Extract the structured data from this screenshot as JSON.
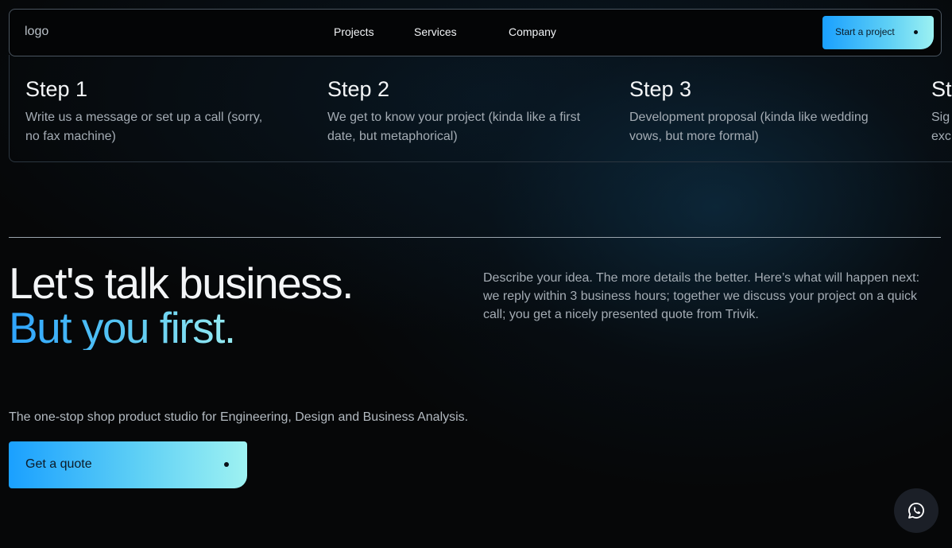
{
  "nav": {
    "logo": "logo",
    "links": [
      "Projects",
      "Services",
      "Company"
    ],
    "cta_label": "Start a project"
  },
  "steps": [
    {
      "title": "Step 1",
      "description": "Write us a message or set up a call (sorry, no fax machine)"
    },
    {
      "title": "Step 2",
      "description": "We get to know your project (kinda like a first date, but metaphorical)"
    },
    {
      "title": "Step 3",
      "description": "Development proposal (kinda like wedding vows, but more formal)"
    },
    {
      "title": "St",
      "description": "Sig exc"
    }
  ],
  "hero": {
    "headline_line1": "Let's talk business.",
    "headline_line2": "But you first.",
    "intro": "Describe your idea. The more details the better. Here’s what will happen next: we reply within 3 business hours; together we discuss your project on a quick call; you get a nicely presented quote from Trivik.",
    "tagline": "The one-stop shop product studio for Engineering, Design and Business Analysis.",
    "cta_label": "Get a quote"
  },
  "chat": {
    "icon": "whatsapp-icon"
  },
  "colors": {
    "background": "#060708",
    "accent_start": "#1aa0ff",
    "accent_end": "#9ef2f2",
    "muted_text": "#a4acb4"
  }
}
